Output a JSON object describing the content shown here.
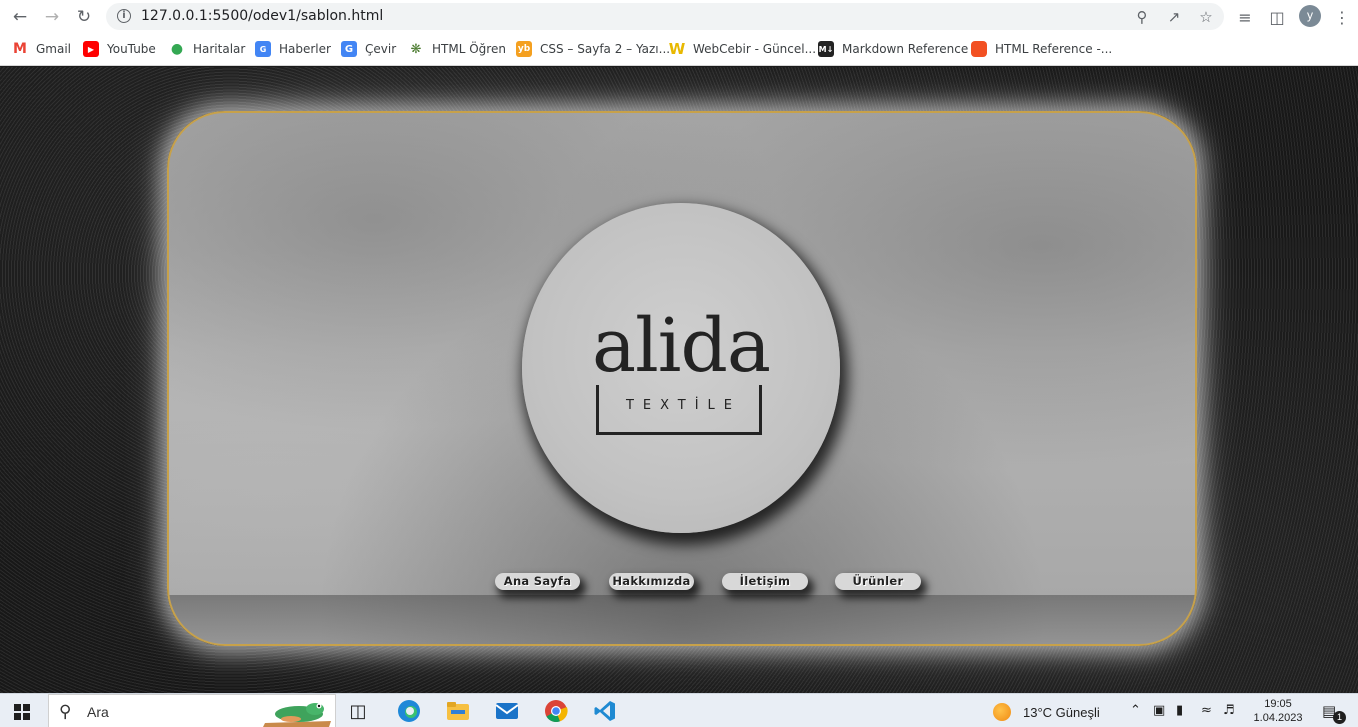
{
  "browser": {
    "url": "127.0.0.1:5500/odev1/sablon.html",
    "profile_initial": "y",
    "icons": {
      "back": "arrow-left-icon",
      "forward": "arrow-right-icon",
      "reload": "reload-icon",
      "info": "info-icon",
      "zoom": "zoom-icon",
      "share": "share-icon",
      "bookmark": "star-icon",
      "reading_list": "reading-list-icon",
      "side_panel": "side-panel-icon",
      "menu": "kebab-menu-icon"
    }
  },
  "bookmarks": [
    {
      "label": "Gmail",
      "icon": "gmail-icon",
      "color": "#ea4335"
    },
    {
      "label": "YouTube",
      "icon": "youtube-icon",
      "color": "#ff0000"
    },
    {
      "label": "Haritalar",
      "icon": "maps-icon",
      "color": "#34a853"
    },
    {
      "label": "Haberler",
      "icon": "news-icon",
      "color": "#4285f4"
    },
    {
      "label": "Çevir",
      "icon": "translate-icon",
      "color": "#4285f4"
    },
    {
      "label": "HTML Öğren",
      "icon": "bug-icon",
      "color": "#4a7a2e"
    },
    {
      "label": "CSS – Sayfa 2 – Yazı...",
      "icon": "yb-icon",
      "color": "#f4a020"
    },
    {
      "label": "WebCebir - Güncel...",
      "icon": "w-icon",
      "color": "#f2c500"
    },
    {
      "label": "Markdown Reference",
      "icon": "markdown-icon",
      "color": "#222222"
    },
    {
      "label": "HTML Reference -...",
      "icon": "html-ref-icon",
      "color": "#f25022"
    }
  ],
  "page": {
    "logo_word": "alida",
    "logo_sub": "TEXTİLE",
    "menu": [
      "Ana Sayfa",
      "Hakkımızda",
      "İletişim",
      "Ürünler"
    ],
    "colors": {
      "panel_border": "#c7a14a",
      "logo_ink": "#232323"
    }
  },
  "taskbar": {
    "search_placeholder": "Ara",
    "weather": "13°C  Güneşli",
    "time": "19:05",
    "date": "1.04.2023",
    "notification_count": "1",
    "apps": [
      "task-view-icon",
      "edge-icon",
      "file-explorer-icon",
      "mail-icon",
      "chrome-icon",
      "vscode-icon"
    ]
  }
}
